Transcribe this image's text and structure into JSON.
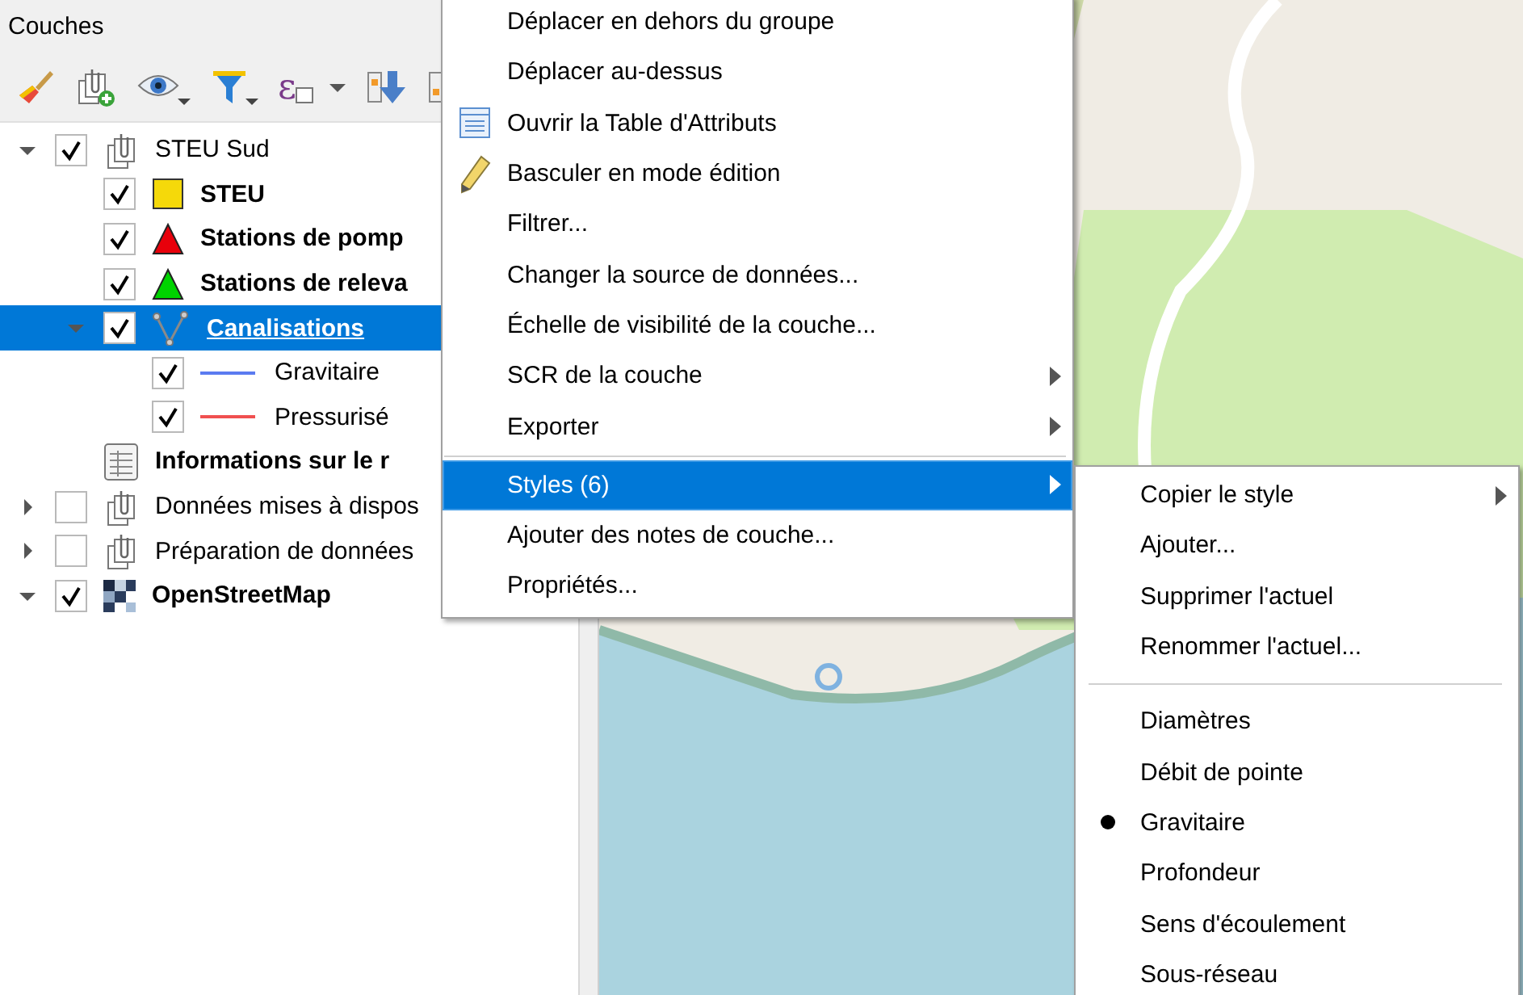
{
  "panel": {
    "title": "Couches",
    "expression_symbol": "ɛ"
  },
  "layers": [
    {
      "label": "STEU Sud",
      "kind": "group",
      "bold": false,
      "checked": true,
      "expanded": true,
      "selected": false,
      "children": [
        {
          "label": "STEU",
          "kind": "square",
          "color": "#f5d90a",
          "bold": true,
          "checked": true,
          "selected": false
        },
        {
          "label": "Stations de pomp",
          "kind": "triangle",
          "color": "#e8000b",
          "bold": true,
          "checked": true,
          "selected": false
        },
        {
          "label": "Stations de releva",
          "kind": "triangle",
          "color": "#00d400",
          "bold": true,
          "checked": true,
          "selected": false
        },
        {
          "label": "Canalisations",
          "kind": "line",
          "bold": true,
          "checked": true,
          "expanded": true,
          "selected": true,
          "children": [
            {
              "label": "Gravitaire",
              "kind": "legend",
              "color": "#5b7bf0",
              "bold": false,
              "checked": true,
              "selected": false
            },
            {
              "label": "Pressurisé",
              "kind": "legend",
              "color": "#f05050",
              "bold": false,
              "checked": true,
              "selected": false
            }
          ]
        }
      ]
    },
    {
      "label": "Informations sur le r",
      "kind": "table",
      "bold": true,
      "selected": false
    },
    {
      "label": "Données mises à dispos",
      "kind": "group",
      "bold": false,
      "checked": false,
      "expanded": false,
      "selected": false
    },
    {
      "label": "Préparation de données",
      "kind": "group",
      "bold": false,
      "checked": false,
      "expanded": false,
      "selected": false
    },
    {
      "label": "OpenStreetMap",
      "kind": "raster",
      "bold": true,
      "checked": true,
      "expanded": true,
      "selected": false
    }
  ],
  "context_menu": {
    "items": [
      {
        "kind": "action",
        "label": "Déplacer en dehors du groupe",
        "selected": false
      },
      {
        "kind": "action",
        "label": "Déplacer au-dessus",
        "selected": false
      },
      {
        "kind": "action",
        "label": "Ouvrir la Table d'Attributs",
        "selected": false
      },
      {
        "kind": "action",
        "label": "Basculer en mode édition",
        "selected": false
      },
      {
        "kind": "action",
        "label": "Filtrer...",
        "selected": false
      },
      {
        "kind": "action",
        "label": "Changer la source de données...",
        "selected": false
      },
      {
        "kind": "action",
        "label": "Échelle de visibilité de la couche...",
        "selected": false
      },
      {
        "kind": "submenu",
        "label": "SCR de la couche",
        "selected": false
      },
      {
        "kind": "submenu",
        "label": "Exporter",
        "selected": false
      },
      {
        "kind": "separator"
      },
      {
        "kind": "submenu",
        "label": "Styles (6)",
        "selected": true
      },
      {
        "kind": "action",
        "label": "Ajouter des notes de couche...",
        "selected": false
      },
      {
        "kind": "action",
        "label": "Propriétés...",
        "selected": false
      }
    ]
  },
  "styles_submenu": {
    "items": [
      {
        "kind": "submenu",
        "label": "Copier le style"
      },
      {
        "kind": "action",
        "label": "Ajouter..."
      },
      {
        "kind": "action",
        "label": "Supprimer l'actuel"
      },
      {
        "kind": "action",
        "label": "Renommer l'actuel..."
      },
      {
        "kind": "separator"
      },
      {
        "kind": "style",
        "label": "Diamètres",
        "checked": false
      },
      {
        "kind": "style",
        "label": "Débit de pointe",
        "checked": false
      },
      {
        "kind": "style",
        "label": "Gravitaire",
        "checked": true
      },
      {
        "kind": "style",
        "label": "Profondeur",
        "checked": false
      },
      {
        "kind": "style",
        "label": "Sens d'écoulement",
        "checked": false
      },
      {
        "kind": "style",
        "label": "Sous-réseau",
        "checked": false
      }
    ]
  }
}
